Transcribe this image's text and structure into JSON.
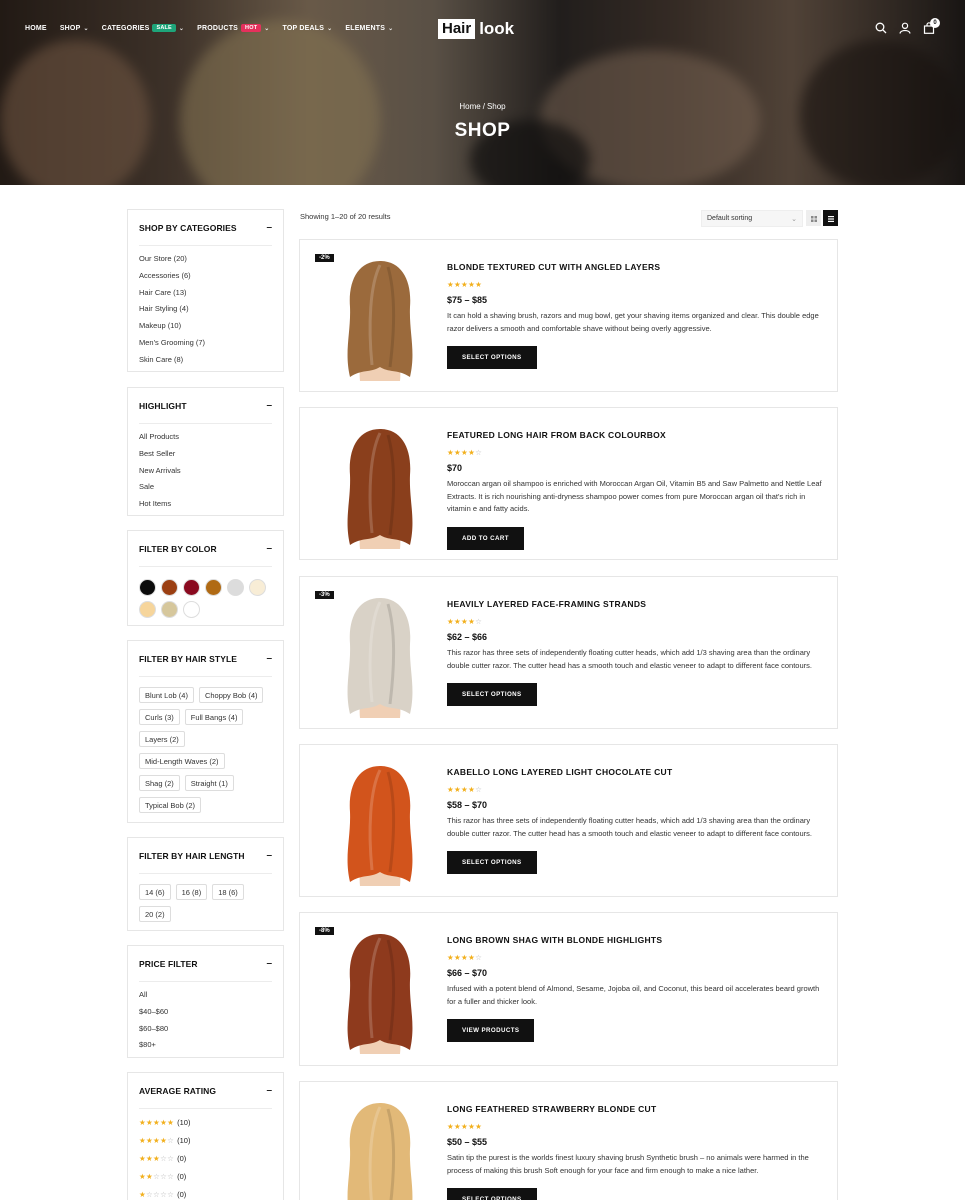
{
  "colors": {
    "accent": "#111111",
    "star": "#f2b01e",
    "sale_badge": "#1ea57a",
    "hot_badge": "#e5305c"
  },
  "nav": {
    "items": [
      {
        "label": "HOME"
      },
      {
        "label": "SHOP"
      },
      {
        "label": "CATEGORIES",
        "badge": "SALE"
      },
      {
        "label": "PRODUCTS",
        "badge": "HOT"
      },
      {
        "label": "TOP DEALS"
      },
      {
        "label": "ELEMENTS"
      }
    ]
  },
  "logo": {
    "box": "Hair",
    "rest": "look"
  },
  "header_icons": {
    "search": "search-icon",
    "account": "user-icon",
    "cart": "shopping-bag-icon",
    "cart_count": "0"
  },
  "breadcrumb": {
    "home": "Home",
    "sep": "/",
    "current": "Shop"
  },
  "page_title": "SHOP",
  "sidebar": {
    "categories": {
      "title": "SHOP BY CATEGORIES",
      "items": [
        "Our Store (20)",
        "Accessories (6)",
        "Hair Care (13)",
        "Hair Styling (4)",
        "Makeup (10)",
        "Men's Grooming (7)",
        "Skin Care (8)"
      ]
    },
    "highlight": {
      "title": "HIGHLIGHT",
      "items": [
        "All Products",
        "Best Seller",
        "New Arrivals",
        "Sale",
        "Hot Items"
      ]
    },
    "color": {
      "title": "FILTER BY COLOR",
      "swatches": [
        "#0b0b0b",
        "#9b3f12",
        "#8a0a1f",
        "#b06a14",
        "#dcdcdc",
        "#f8edd6",
        "#f6d59b",
        "#d6c79c",
        "#ffffff"
      ]
    },
    "hair_style": {
      "title": "FILTER BY HAIR STYLE",
      "tags": [
        "Blunt Lob (4)",
        "Choppy Bob (4)",
        "Curls (3)",
        "Full Bangs (4)",
        "Layers (2)",
        "Mid-Length Waves (2)",
        "Shag (2)",
        "Straight (1)",
        "Typical Bob (2)"
      ]
    },
    "hair_length": {
      "title": "FILTER BY HAIR LENGTH",
      "tags": [
        "14 (6)",
        "16 (8)",
        "18 (6)",
        "20 (2)"
      ]
    },
    "price": {
      "title": "PRICE FILTER",
      "items": [
        "All",
        "$40–$60",
        "$60–$80",
        "$80+"
      ]
    },
    "rating": {
      "title": "AVERAGE RATING",
      "rows": [
        {
          "stars": 5,
          "count": "(10)"
        },
        {
          "stars": 4,
          "count": "(10)"
        },
        {
          "stars": 3,
          "count": "(0)"
        },
        {
          "stars": 2,
          "count": "(0)"
        },
        {
          "stars": 1,
          "count": "(0)"
        }
      ]
    },
    "toggle_symbol": "–"
  },
  "toolbar": {
    "results": "Showing 1–20 of 20 results",
    "sort": "Default sorting",
    "grid_icon": "grid-view-icon",
    "list_icon": "list-view-icon"
  },
  "products": [
    {
      "badge": "-2%",
      "title": "BLONDE TEXTURED CUT WITH ANGLED LAYERS",
      "rating": 5,
      "price": "$75 – $85",
      "desc": "It can hold a shaving brush, razors and mug bowl, get your shaving items organized and clear. This double edge razor delivers a smooth and comfortable shave without being overly aggressive.",
      "button": "SELECT OPTIONS",
      "hair": "#9b6a3c"
    },
    {
      "badge": "",
      "title": "FEATURED LONG HAIR FROM BACK COLOURBOX",
      "rating": 4,
      "price": "$70",
      "desc": "Moroccan argan oil shampoo is enriched with Moroccan Argan Oil, Vitamin B5 and Saw Palmetto and Nettle Leaf Extracts. It is rich nourishing anti-dryness shampoo power comes from pure Moroccan argan oil that's rich in vitamin e and fatty acids.",
      "button": "ADD TO CART",
      "hair": "#8a3f1c"
    },
    {
      "badge": "-3%",
      "title": "HEAVILY LAYERED FACE-FRAMING STRANDS",
      "rating": 4,
      "price": "$62 – $66",
      "desc": "This razor has three sets of independently floating cutter heads, which add 1/3 shaving area than the ordinary double cutter razor. The cutter head has a smooth touch and elastic veneer to adapt to different face contours.",
      "button": "SELECT OPTIONS",
      "hair": "#d9d2c7"
    },
    {
      "badge": "",
      "title": "KABELLO LONG LAYERED LIGHT CHOCOLATE CUT",
      "rating": 4,
      "price": "$58 – $70",
      "desc": "This razor has three sets of independently floating cutter heads, which add 1/3 shaving area than the ordinary double cutter razor. The cutter head has a smooth touch and elastic veneer to adapt to different face contours.",
      "button": "SELECT OPTIONS",
      "hair": "#d2541c"
    },
    {
      "badge": "-8%",
      "title": "LONG BROWN SHAG WITH BLONDE HIGHLIGHTS",
      "rating": 4,
      "price": "$66 – $70",
      "desc": "Infused with a potent blend of Almond, Sesame, Jojoba oil, and Coconut, this beard oil accelerates beard growth for a fuller and thicker look.",
      "button": "VIEW PRODUCTS",
      "hair": "#8e3a1d"
    },
    {
      "badge": "",
      "title": "LONG FEATHERED STRAWBERRY BLONDE CUT",
      "rating": 5,
      "price": "$50 – $55",
      "desc": "Satin tip the purest is the worlds finest luxury shaving brush Synthetic brush – no animals were harmed in the process of making this brush Soft enough for your face and firm enough to make a nice lather.",
      "button": "SELECT OPTIONS",
      "hair": "#e2b978"
    }
  ]
}
